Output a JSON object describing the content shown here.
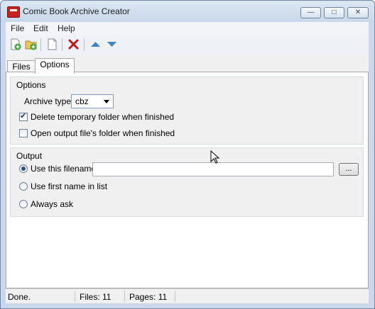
{
  "window": {
    "title": "Comic Book Archive Creator"
  },
  "menu": [
    "File",
    "Edit",
    "Help"
  ],
  "toolbar": {
    "icons": [
      "add-file-icon",
      "add-folder-icon",
      "new-document-icon",
      "delete-icon",
      "move-up-icon",
      "move-down-icon"
    ],
    "colors": {
      "delete": "#c0171b",
      "arrows": "#3f83c9",
      "add": "#3aa43a"
    }
  },
  "tabs": [
    {
      "label": "Files",
      "active": false
    },
    {
      "label": "Options",
      "active": true
    }
  ],
  "options": {
    "group_title": "Options",
    "archive_type_label": "Archive type:",
    "archive_type_value": "cbz",
    "delete_temp_label": "Delete temporary folder when finished",
    "delete_temp_checked": true,
    "open_output_label": "Open output file's folder when finished",
    "open_output_checked": false
  },
  "output": {
    "group_title": "Output",
    "use_filename_label": "Use this filename:",
    "use_filename_selected": true,
    "filename_value": "",
    "browse_label": "...",
    "first_name_label": "Use first name in list",
    "always_ask_label": "Always ask"
  },
  "status": {
    "state": "Done.",
    "files": "Files: 11",
    "pages": "Pages: 11"
  }
}
